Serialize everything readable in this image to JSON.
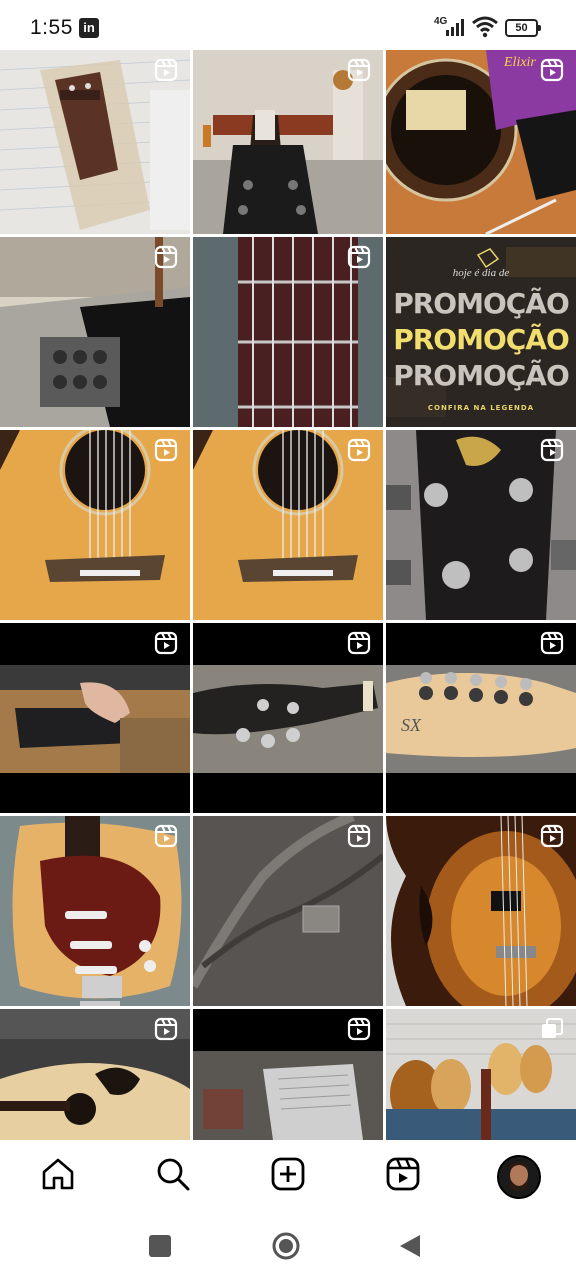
{
  "status_bar": {
    "time": "1:55",
    "app_badge": "in",
    "network": "4G",
    "battery": "50"
  },
  "grid": {
    "tiles": [
      {
        "name": "tile-bridge-repair",
        "reel": true
      },
      {
        "name": "tile-guitar-neck-headstock",
        "reel": true
      },
      {
        "name": "tile-elixir-strings",
        "reel": true
      },
      {
        "name": "tile-ibanez-tuners",
        "reel": true
      },
      {
        "name": "tile-fretboard",
        "reel": true
      },
      {
        "name": "tile-promotion",
        "reel": false,
        "script_text": "hoje é dia de",
        "lines": [
          "PROMOÇÃO",
          "PROMOÇÃO",
          "PROMOÇÃO"
        ],
        "footer": "CONFIRA NA LEGENDA"
      },
      {
        "name": "tile-acoustic-soundhole-1",
        "reel": true
      },
      {
        "name": "tile-acoustic-soundhole-2",
        "reel": true
      },
      {
        "name": "tile-headstock-tuners",
        "reel": true
      },
      {
        "name": "tile-fender-headstock-repair",
        "reel": true
      },
      {
        "name": "tile-epiphone-headstock",
        "reel": true
      },
      {
        "name": "tile-sx-headstock",
        "reel": true
      },
      {
        "name": "tile-stratocaster-body",
        "reel": true
      },
      {
        "name": "tile-fender-case-logo",
        "reel": true
      },
      {
        "name": "tile-archtop-sunburst",
        "reel": true
      },
      {
        "name": "tile-acoustic-workshop",
        "reel": true
      },
      {
        "name": "tile-workbench-papers",
        "reel": true
      },
      {
        "name": "tile-guitar-store-wall",
        "reel": false
      }
    ]
  },
  "bottom_nav": {
    "items": [
      "home",
      "search",
      "create",
      "reels",
      "profile"
    ]
  }
}
